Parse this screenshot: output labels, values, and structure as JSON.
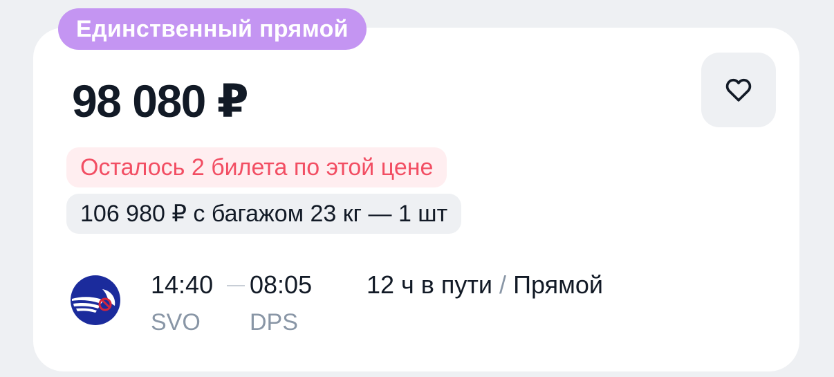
{
  "badge": {
    "label": "Единственный прямой",
    "color": "#c495f2"
  },
  "offer": {
    "price": "98 080 ₽",
    "tickets_left": "Осталось 2 билета по этой цене",
    "baggage_option": "106 980 ₽ с багажом 23 кг — 1 шт"
  },
  "favorite": {
    "icon": "heart-icon"
  },
  "flight": {
    "airline_logo": "aeroflot-logo",
    "departure_time": "14:40",
    "arrival_time": "08:05",
    "departure_code": "SVO",
    "arrival_code": "DPS",
    "duration": "12 ч в пути",
    "separator": "/",
    "stops": "Прямой"
  },
  "colors": {
    "accent_red": "#f24e63",
    "muted": "#8996a6",
    "background": "#eef0f3"
  }
}
